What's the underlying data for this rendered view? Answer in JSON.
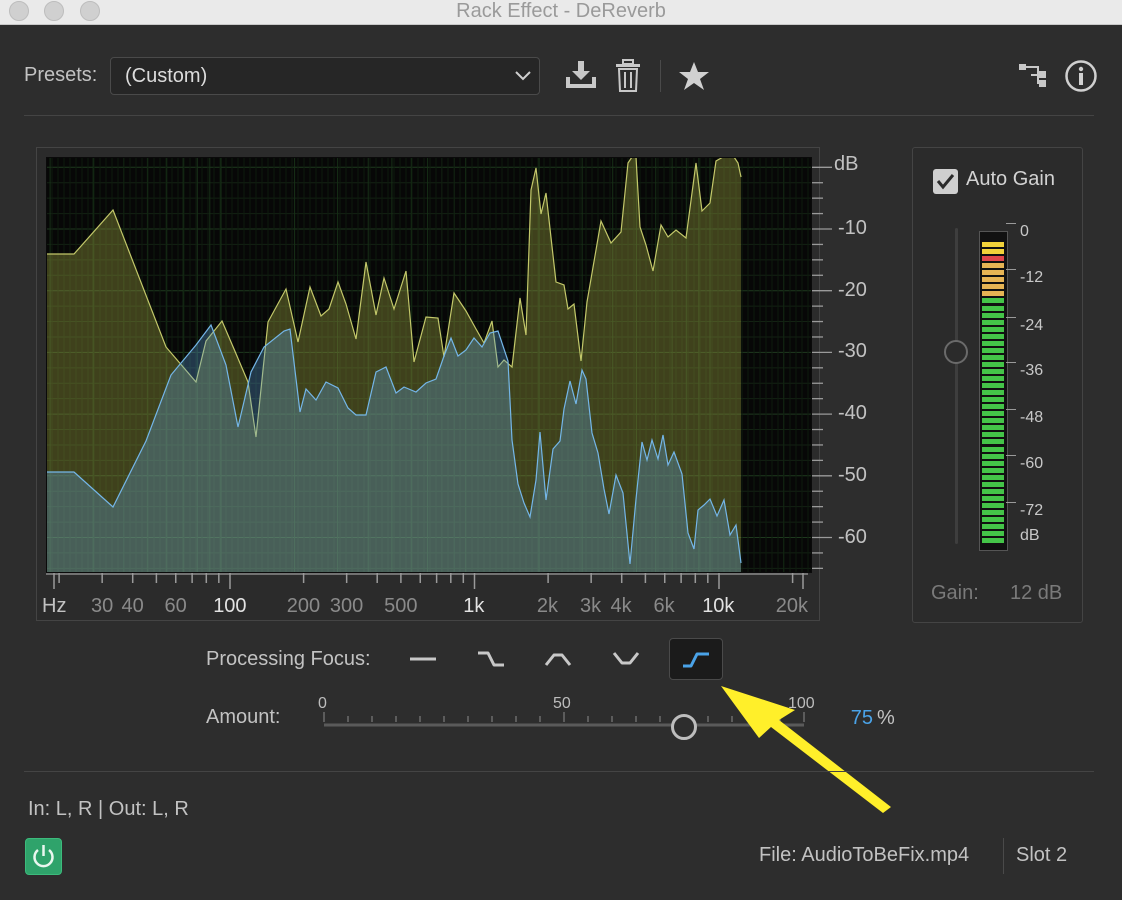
{
  "window": {
    "title": "Rack Effect - DeReverb"
  },
  "presets": {
    "label": "Presets:",
    "value": "(Custom)"
  },
  "graph": {
    "db_unit": "dB",
    "db_ticks": [
      "-10",
      "-20",
      "-30",
      "-40",
      "-50",
      "-60"
    ],
    "hz_unit": "Hz",
    "freq_labels": [
      {
        "t": "30",
        "f": 30,
        "bright": false
      },
      {
        "t": "40",
        "f": 40,
        "bright": false
      },
      {
        "t": "60",
        "f": 60,
        "bright": false
      },
      {
        "t": "100",
        "f": 100,
        "bright": true
      },
      {
        "t": "200",
        "f": 200,
        "bright": false
      },
      {
        "t": "300",
        "f": 300,
        "bright": false
      },
      {
        "t": "500",
        "f": 500,
        "bright": false
      },
      {
        "t": "1k",
        "f": 1000,
        "bright": true
      },
      {
        "t": "2k",
        "f": 2000,
        "bright": false
      },
      {
        "t": "3k",
        "f": 3000,
        "bright": false
      },
      {
        "t": "4k",
        "f": 4000,
        "bright": false
      },
      {
        "t": "6k",
        "f": 6000,
        "bright": false
      },
      {
        "t": "10k",
        "f": 10000,
        "bright": true
      },
      {
        "t": "20k",
        "f": 20000,
        "bright": false
      }
    ],
    "colors": {
      "input": "#9aa03e",
      "output": "#5a9fd4",
      "background": "#070707"
    }
  },
  "gain": {
    "auto_gain_label": "Auto Gain",
    "auto_gain_checked": true,
    "meter_ticks": [
      "0",
      "-12",
      "-24",
      "-36",
      "-48",
      "-60",
      "-72",
      "dB"
    ],
    "gain_label": "Gain:",
    "gain_value": "12 dB"
  },
  "focus": {
    "label": "Processing Focus:",
    "options": [
      {
        "icon": "flat-focus-icon",
        "selected": false
      },
      {
        "icon": "low-focus-icon",
        "selected": false
      },
      {
        "icon": "mid-focus-icon",
        "selected": false
      },
      {
        "icon": "notch-focus-icon",
        "selected": false
      },
      {
        "icon": "high-focus-icon",
        "selected": true
      }
    ]
  },
  "amount": {
    "label": "Amount:",
    "scale": [
      "0",
      "50",
      "100"
    ],
    "value": "75",
    "unit": "%",
    "accent": "#4aa3e8"
  },
  "footer": {
    "io": "In: L, R | Out: L, R",
    "file": "File: AudioToBeFix.mp4",
    "slot": "Slot 2"
  }
}
